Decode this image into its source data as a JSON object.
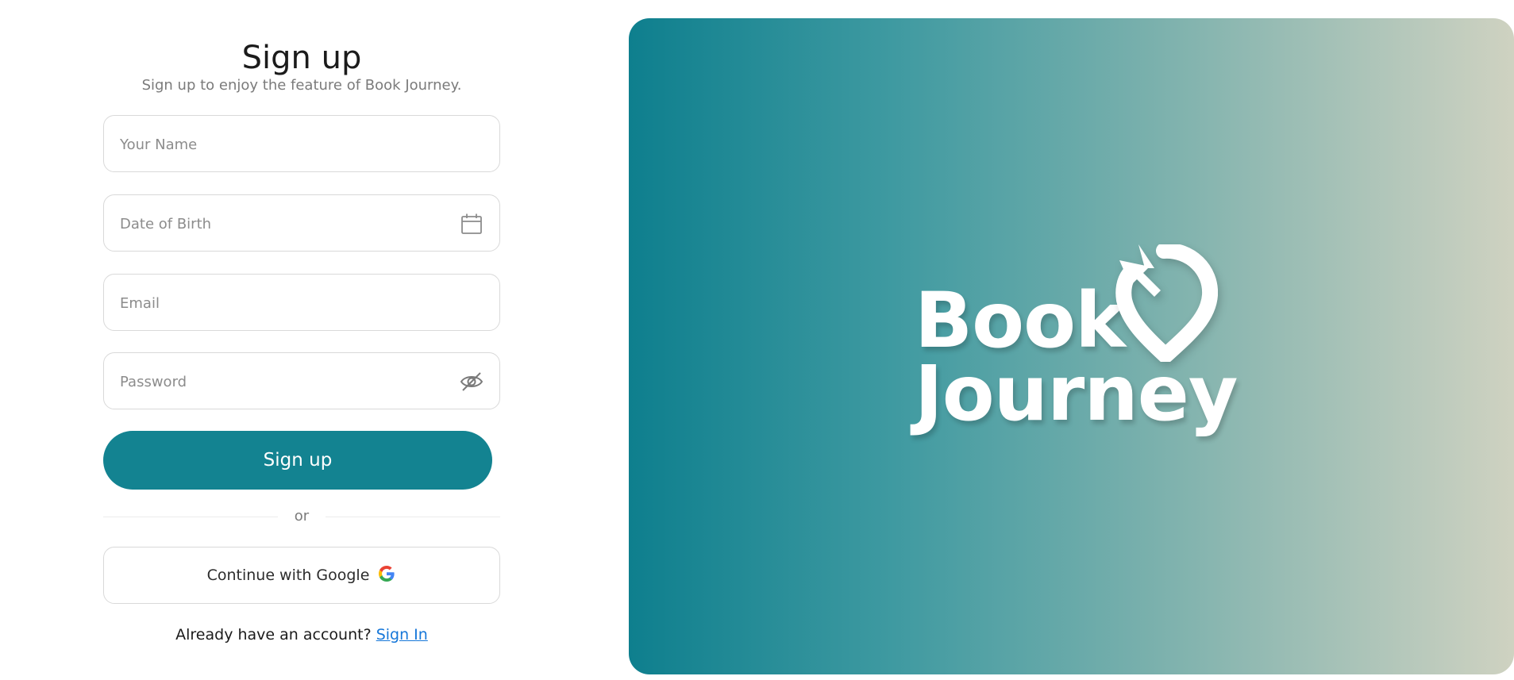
{
  "signup": {
    "title": "Sign up",
    "subtitle": "Sign up to enjoy the feature of Book Journey.",
    "name_placeholder": "Your Name",
    "dob_placeholder": "Date of Birth",
    "email_placeholder": "Email",
    "password_placeholder": "Password",
    "submit_label": "Sign up",
    "divider_text": "or",
    "google_label": "Continue with Google",
    "signin_prompt": "Already have an account?",
    "signin_link": "Sign In"
  },
  "brand": {
    "line1": "Book",
    "line2": "Journey",
    "logo_icon": "location-pin-arrow-icon",
    "gradient_start": "#0e7f8e",
    "gradient_end": "#cfd2c1"
  },
  "icons": {
    "calendar": "calendar-icon",
    "password_toggle": "eye-off-icon",
    "google": "google-g-icon"
  },
  "colors": {
    "primary": "#138391",
    "link": "#1677d9"
  }
}
